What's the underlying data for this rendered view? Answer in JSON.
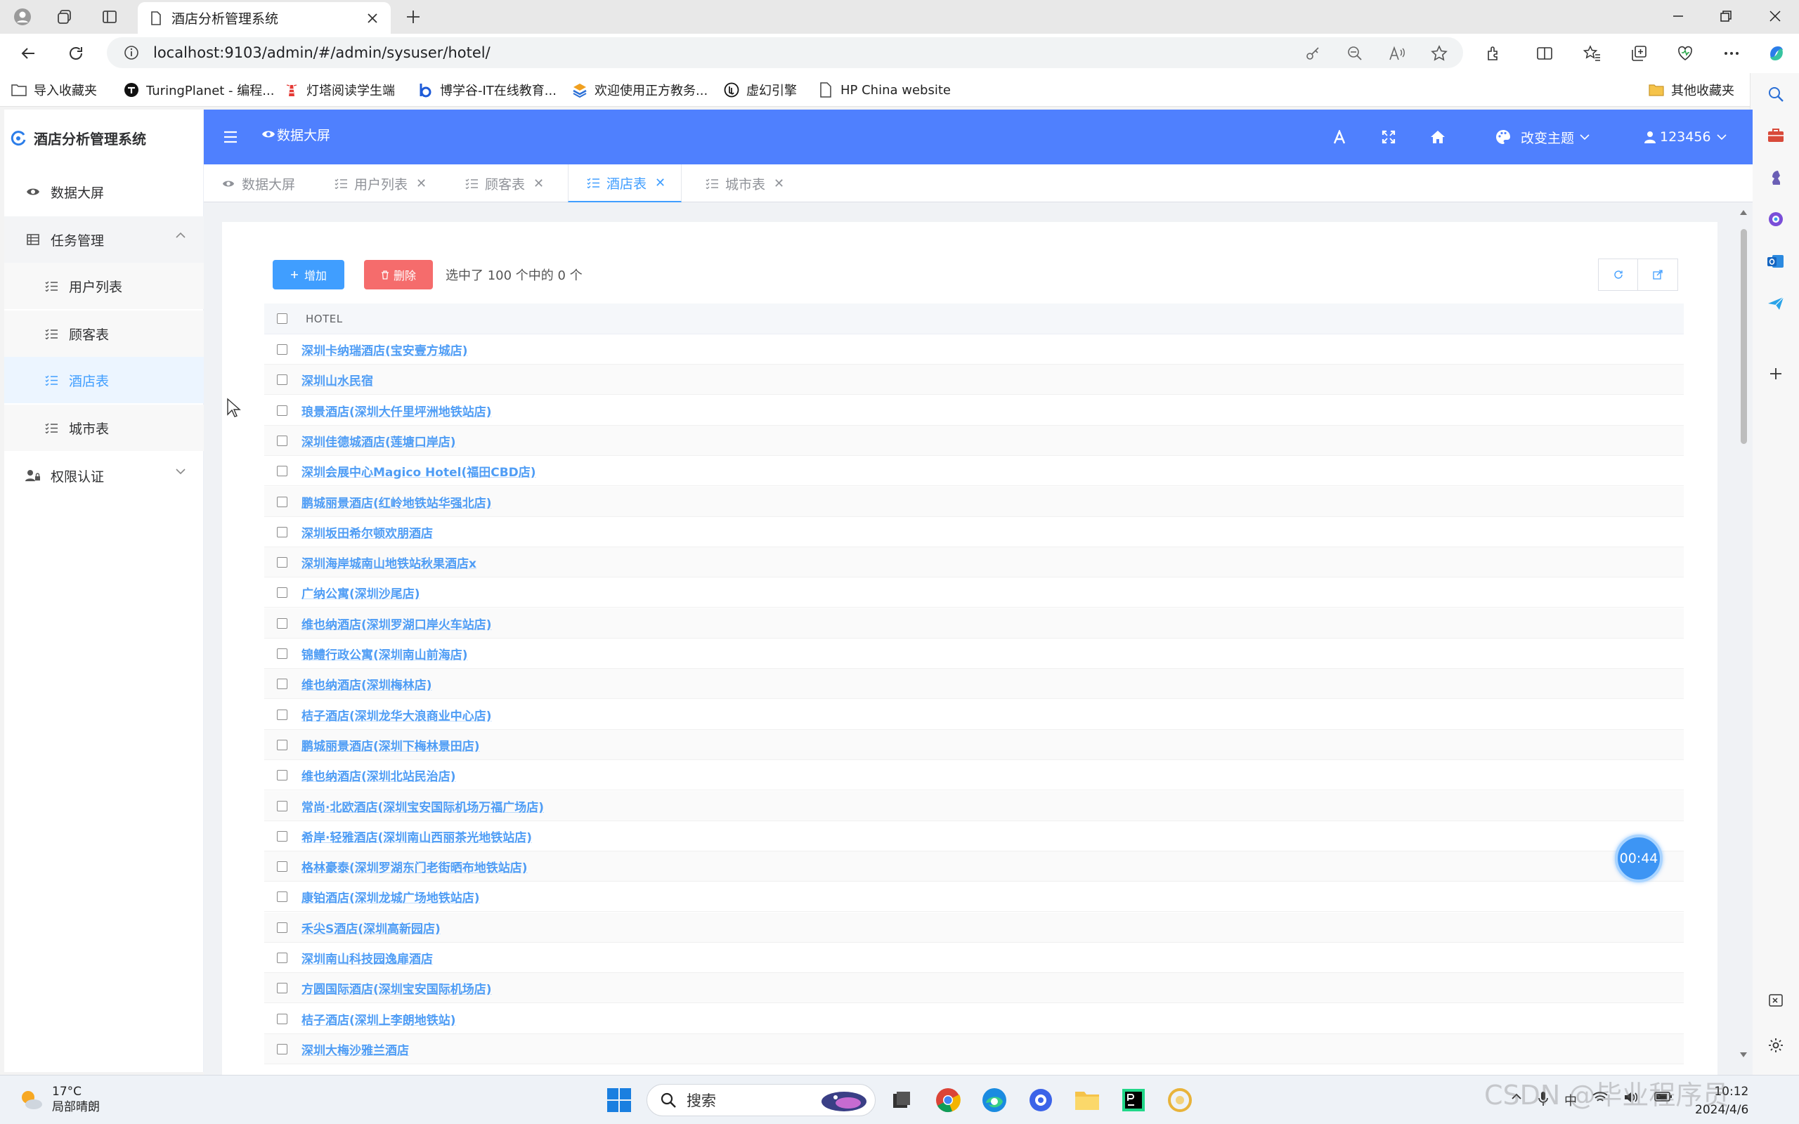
{
  "browser": {
    "tab_title": "酒店分析管理系统",
    "url": "localhost:9103/admin/#/admin/sysuser/hotel/"
  },
  "favorites": [
    {
      "label": "导入收藏夹",
      "icon": "import-folder-icon"
    },
    {
      "label": "TuringPlanet - 编程...",
      "icon": "turingplanet-icon"
    },
    {
      "label": "灯塔阅读学生端",
      "icon": "lighthouse-icon"
    },
    {
      "label": "博学谷-IT在线教育...",
      "icon": "boxuegu-icon"
    },
    {
      "label": "欢迎使用正方教务...",
      "icon": "zhengfang-icon"
    },
    {
      "label": "虚幻引擎",
      "icon": "unreal-icon"
    },
    {
      "label": "HP China website",
      "icon": "page-icon"
    }
  ],
  "favorites_other": "其他收藏夹",
  "app": {
    "title": "酒店分析管理系统",
    "menu": {
      "dashboard": "数据大屏",
      "task_mgmt": "任务管理",
      "sub": [
        "用户列表",
        "顾客表",
        "酒店表",
        "城市表"
      ],
      "auth": "权限认证"
    },
    "topbar": {
      "screen_link": "数据大屏",
      "theme": "改变主题",
      "user": "123456"
    },
    "tags": [
      {
        "label": "数据大屏",
        "closable": false,
        "active": false
      },
      {
        "label": "用户列表",
        "closable": true,
        "active": false
      },
      {
        "label": "顾客表",
        "closable": true,
        "active": false
      },
      {
        "label": "酒店表",
        "closable": true,
        "active": true
      },
      {
        "label": "城市表",
        "closable": true,
        "active": false
      }
    ],
    "toolbar": {
      "add": "增加",
      "delete": "删除",
      "selection": "选中了 100 个中的 0 个"
    },
    "table": {
      "column": "HOTEL",
      "rows": [
        "深圳卡纳瑞酒店(宝安壹方城店)",
        "深圳山水民宿",
        "琅景酒店(深圳大仟里坪洲地铁站店)",
        "深圳佳德城酒店(莲塘口岸店)",
        "深圳会展中心Magico Hotel(福田CBD店)",
        "鹏城丽景酒店(红岭地铁站华强北店)",
        "深圳坂田希尔顿欢朋酒店",
        "深圳海岸城南山地铁站秋果酒店x",
        "广纳公寓(深圳沙尾店)",
        "维也纳酒店(深圳罗湖口岸火车站店)",
        "锦鳢行政公寓(深圳南山前海店)",
        "维也纳酒店(深圳梅林店)",
        "桔子酒店(深圳龙华大浪商业中心店)",
        "鹏城丽景酒店(深圳下梅林景田店)",
        "维也纳酒店(深圳北站民治店)",
        "常尚·北欧酒店(深圳宝安国际机场万福广场店)",
        "希岸·轻雅酒店(深圳南山西丽茶光地铁站店)",
        "格林豪泰(深圳罗湖东门老街晒布地铁站店)",
        "康铂酒店(深圳龙城广场地铁站店)",
        "禾尖S酒店(深圳高新园店)",
        "深圳南山科技园逸扉酒店",
        "方圆国际酒店(深圳宝安国际机场店)",
        "桔子酒店(深圳上李朗地铁站)",
        "深圳大梅沙雅兰酒店"
      ]
    },
    "timer": "00:44"
  },
  "taskbar": {
    "weather_temp": "17°C",
    "weather_desc": "局部晴朗",
    "search": "搜索",
    "time": "10:12",
    "date": "2024/4/6"
  },
  "watermark": "CSDN @毕业程序员",
  "colors": {
    "topbar": "#4f80fe",
    "accent": "#409eff",
    "danger": "#f56c6c",
    "link": "#4f9df5"
  }
}
